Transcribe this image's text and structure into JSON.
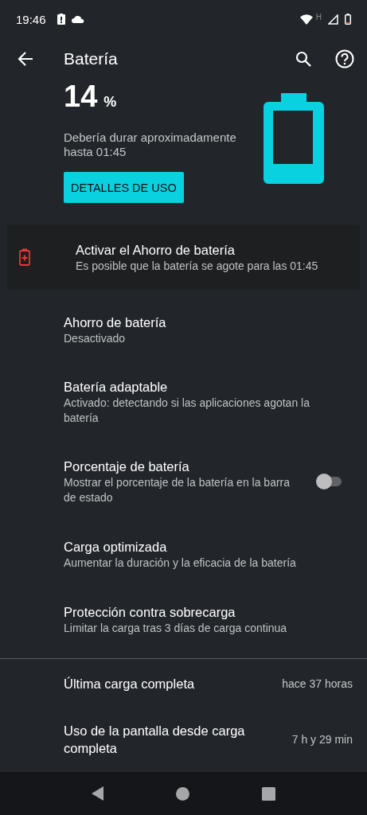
{
  "status_bar": {
    "time": "19:46",
    "network": "H"
  },
  "app_bar": {
    "title": "Batería"
  },
  "summary": {
    "percent": "14",
    "unit": "%",
    "estimate": "Debería durar aproximadamente hasta 01:45",
    "button": "DETALLES DE USO"
  },
  "tip": {
    "title": "Activar el Ahorro de batería",
    "subtitle": "Es posible que la batería se agote para las 01:45"
  },
  "settings": [
    {
      "kind": "plain",
      "title": "Ahorro de batería",
      "subtitle": "Desactivado"
    },
    {
      "kind": "plain",
      "title": "Batería adaptable",
      "subtitle": "Activado: detectando si las aplicaciones agotan la batería"
    },
    {
      "kind": "toggle",
      "title": "Porcentaje de batería",
      "subtitle": "Mostrar el porcentaje de la batería en la barra de estado",
      "on": false
    },
    {
      "kind": "plain",
      "title": "Carga optimizada",
      "subtitle": "Aumentar la duración y la eficacia de la batería"
    },
    {
      "kind": "plain",
      "title": "Protección contra sobrecarga",
      "subtitle": "Limitar la carga tras 3 días de carga continua"
    }
  ],
  "info": [
    {
      "label": "Última carga completa",
      "value": "hace 37 horas"
    },
    {
      "label": "Uso de la pantalla desde carga completa",
      "value": "7 h y 29 min"
    }
  ]
}
